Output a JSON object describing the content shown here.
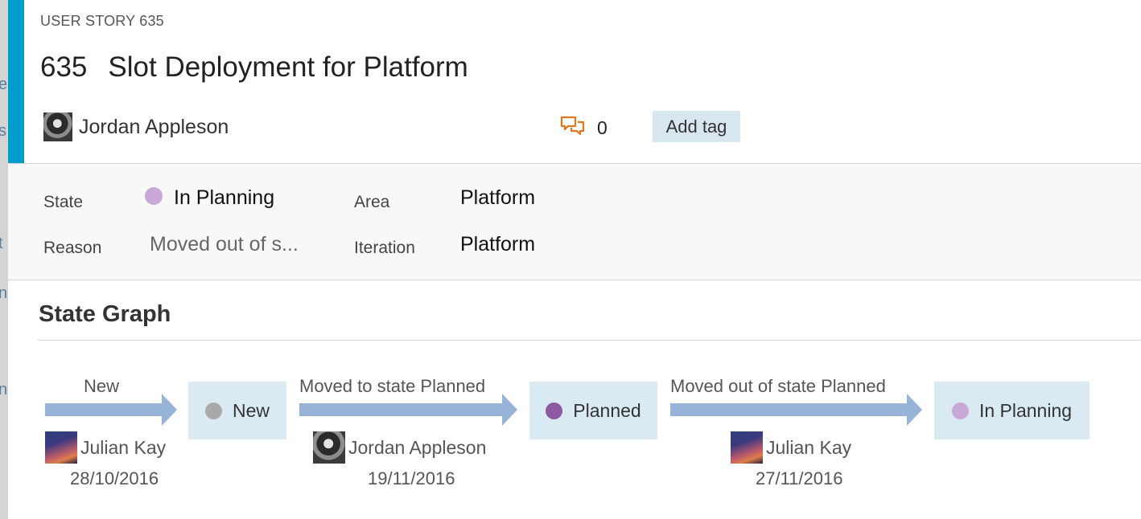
{
  "work_item": {
    "type_label": "USER STORY 635",
    "id": "635",
    "title": "Slot Deployment for Platform",
    "assigned_to": "Jordan Appleson",
    "comment_count": "0",
    "add_tag_label": "Add tag",
    "accent_color": "#009ccc"
  },
  "background_fragments": [
    "e",
    "s",
    "t",
    "n",
    "n"
  ],
  "fields": {
    "state_label": "State",
    "state_value": "In Planning",
    "state_color": "#c9a8d8",
    "reason_label": "Reason",
    "reason_value": "Moved out of s...",
    "area_label": "Area",
    "area_value": "Platform",
    "iteration_label": "Iteration",
    "iteration_value": "Platform"
  },
  "state_graph": {
    "title": "State Graph",
    "arrow_color": "#97b4d8",
    "transitions": [
      {
        "label": "New",
        "actor": "Julian Kay",
        "date": "28/10/2016",
        "avatar_icon": "julian-avatar"
      },
      {
        "label": "Moved to state Planned",
        "actor": "Jordan Appleson",
        "date": "19/11/2016",
        "avatar_icon": "jordan-avatar"
      },
      {
        "label": "Moved out of state Planned",
        "actor": "Julian Kay",
        "date": "27/11/2016",
        "avatar_icon": "julian-avatar"
      }
    ],
    "states": [
      {
        "name": "New",
        "color": "#a9a9a9"
      },
      {
        "name": "Planned",
        "color": "#8b5aa0"
      },
      {
        "name": "In Planning",
        "color": "#c9a8d8"
      }
    ]
  }
}
